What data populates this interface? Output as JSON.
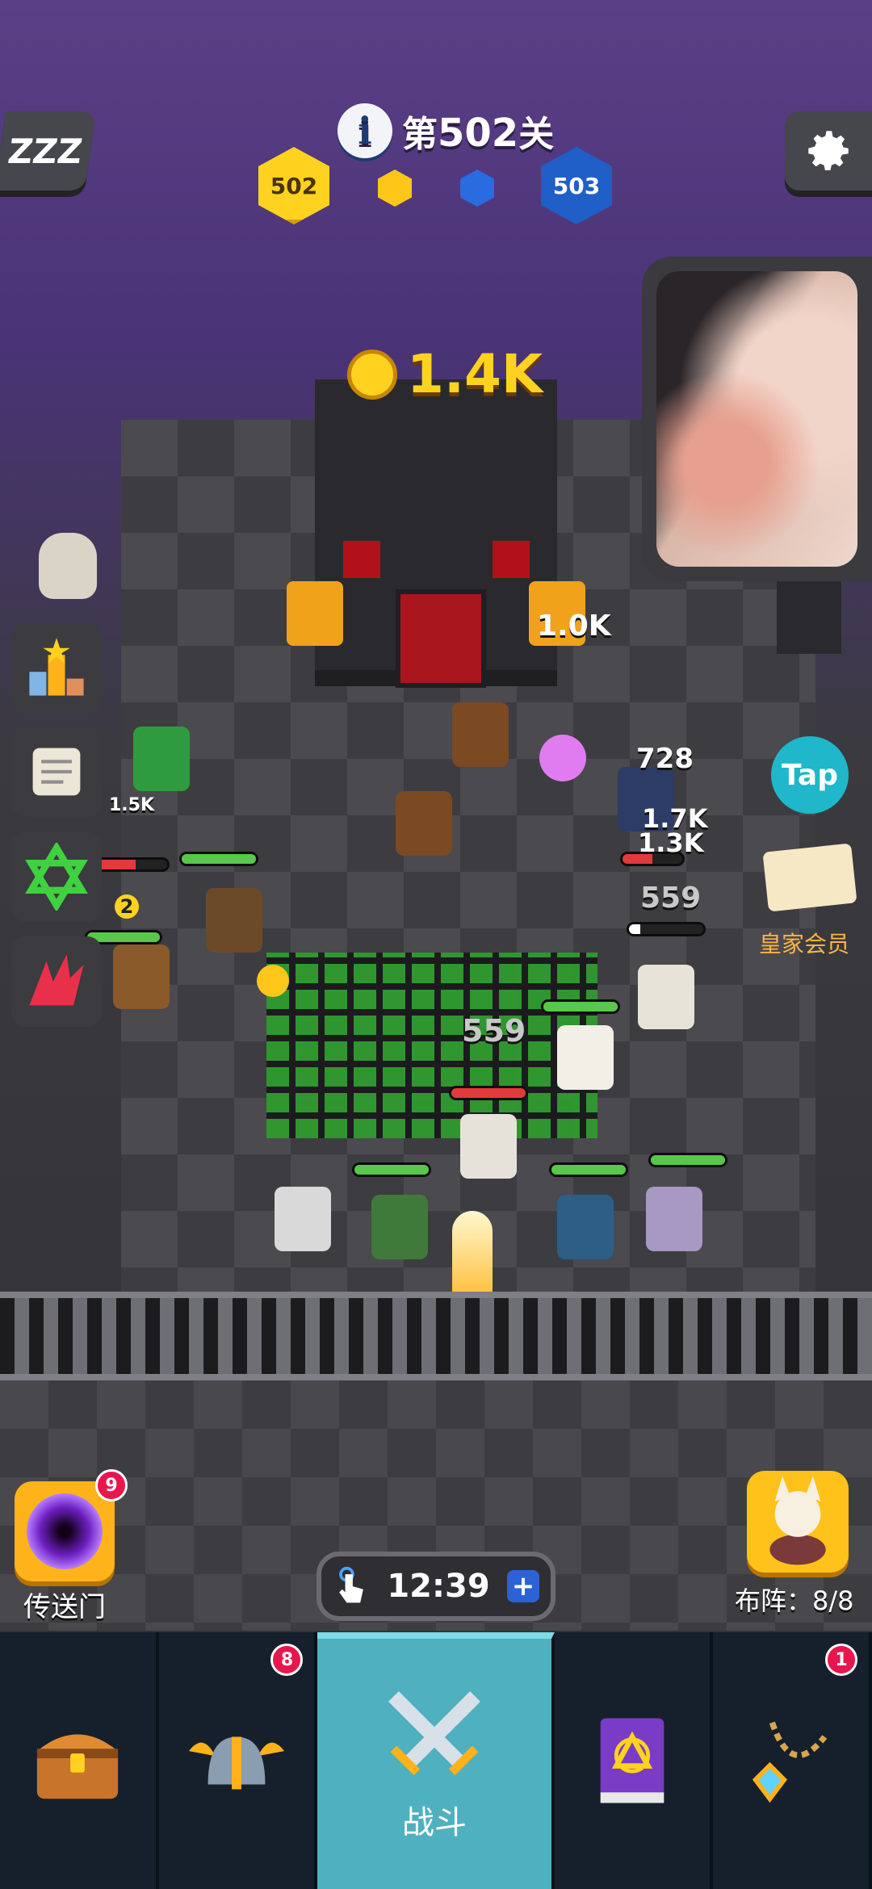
{
  "hud": {
    "level_prefix": "第",
    "level_number": "502",
    "level_suffix": "关",
    "current_level_badge": "502",
    "next_level_badge": "503",
    "info_icon": "i",
    "sleep_label": "ZZZ",
    "settings_icon": "gear-icon"
  },
  "rewards": {
    "castle_gold": "1.4K"
  },
  "damage_numbers": [
    "1.0K",
    "1.5K",
    "728",
    "1.7K",
    "1.3K",
    "559",
    "559",
    "2"
  ],
  "right_panel": {
    "tap_label": "Tap",
    "vip_label": "皇家会员"
  },
  "portal": {
    "label": "传送门",
    "badge": "9"
  },
  "formation": {
    "label": "布阵：8/8"
  },
  "timer": {
    "value": "12:39",
    "plus": "+"
  },
  "nav": {
    "items": [
      {
        "icon": "treasure-chest-icon",
        "label": "",
        "badge": ""
      },
      {
        "icon": "viking-helmet-icon",
        "label": "",
        "badge": "8"
      },
      {
        "icon": "crossed-swords-icon",
        "label": "战斗",
        "badge": ""
      },
      {
        "icon": "spell-book-icon",
        "label": "",
        "badge": ""
      },
      {
        "icon": "amulet-icon",
        "label": "",
        "badge": "1"
      }
    ]
  },
  "colors": {
    "sky": "#5b3f86",
    "gold": "#ffd21f",
    "blue": "#1f5fc7",
    "nav_active": "#4fb0bf",
    "badge": "#e8164d"
  }
}
